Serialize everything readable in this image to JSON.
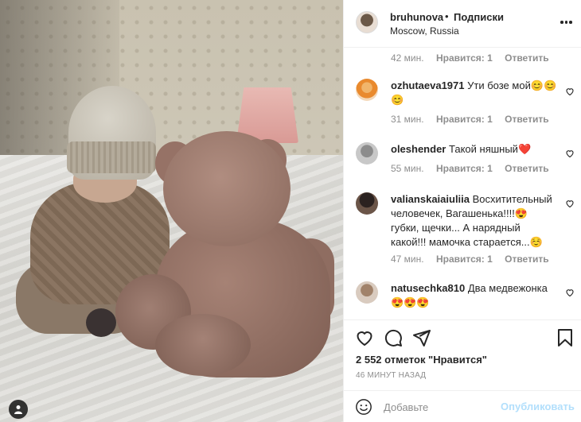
{
  "header": {
    "username": "bruhunova",
    "separator": "•",
    "follow_label": "Подписки",
    "location": "Moscow, Russia"
  },
  "comments": {
    "top_meta": {
      "time": "42 мин.",
      "likes": "Нравится: 1",
      "reply": "Ответить"
    },
    "items": [
      {
        "user": "ozhutaeva1971",
        "text": "Ути бозе мой😊😊😊",
        "time": "31 мин.",
        "likes": "Нравится: 1",
        "reply": "Ответить"
      },
      {
        "user": "oleshender",
        "text": "Такой няшный❤️",
        "time": "55 мин.",
        "likes": "Нравится: 1",
        "reply": "Ответить"
      },
      {
        "user": "valianskaiaiuliia",
        "text": "Восхитительный человечек, Вагашенька!!!!😍 губки, щечки... А нарядный какой!!! мамочка старается...☺️",
        "time": "47 мин.",
        "likes": "Нравится: 1",
        "reply": "Ответить"
      },
      {
        "user": "natusechka810",
        "text": "Два медвежонка 😍😍😍"
      }
    ]
  },
  "actions": {
    "likes_count": "2 552 отметок \"Нравится\"",
    "posted": "46 МИНУТ НАЗАД"
  },
  "comment_bar": {
    "placeholder": "Добавьте",
    "post_label": "Опубликовать"
  },
  "colors": {
    "text": "#262626",
    "muted": "#8e8e8e",
    "post_disabled": "#b2dffc",
    "heart": "#ed4956"
  },
  "icons": [
    "more-icon",
    "heart-icon",
    "comment-icon",
    "share-icon",
    "bookmark-icon",
    "emoji-icon",
    "user-tag-icon"
  ]
}
